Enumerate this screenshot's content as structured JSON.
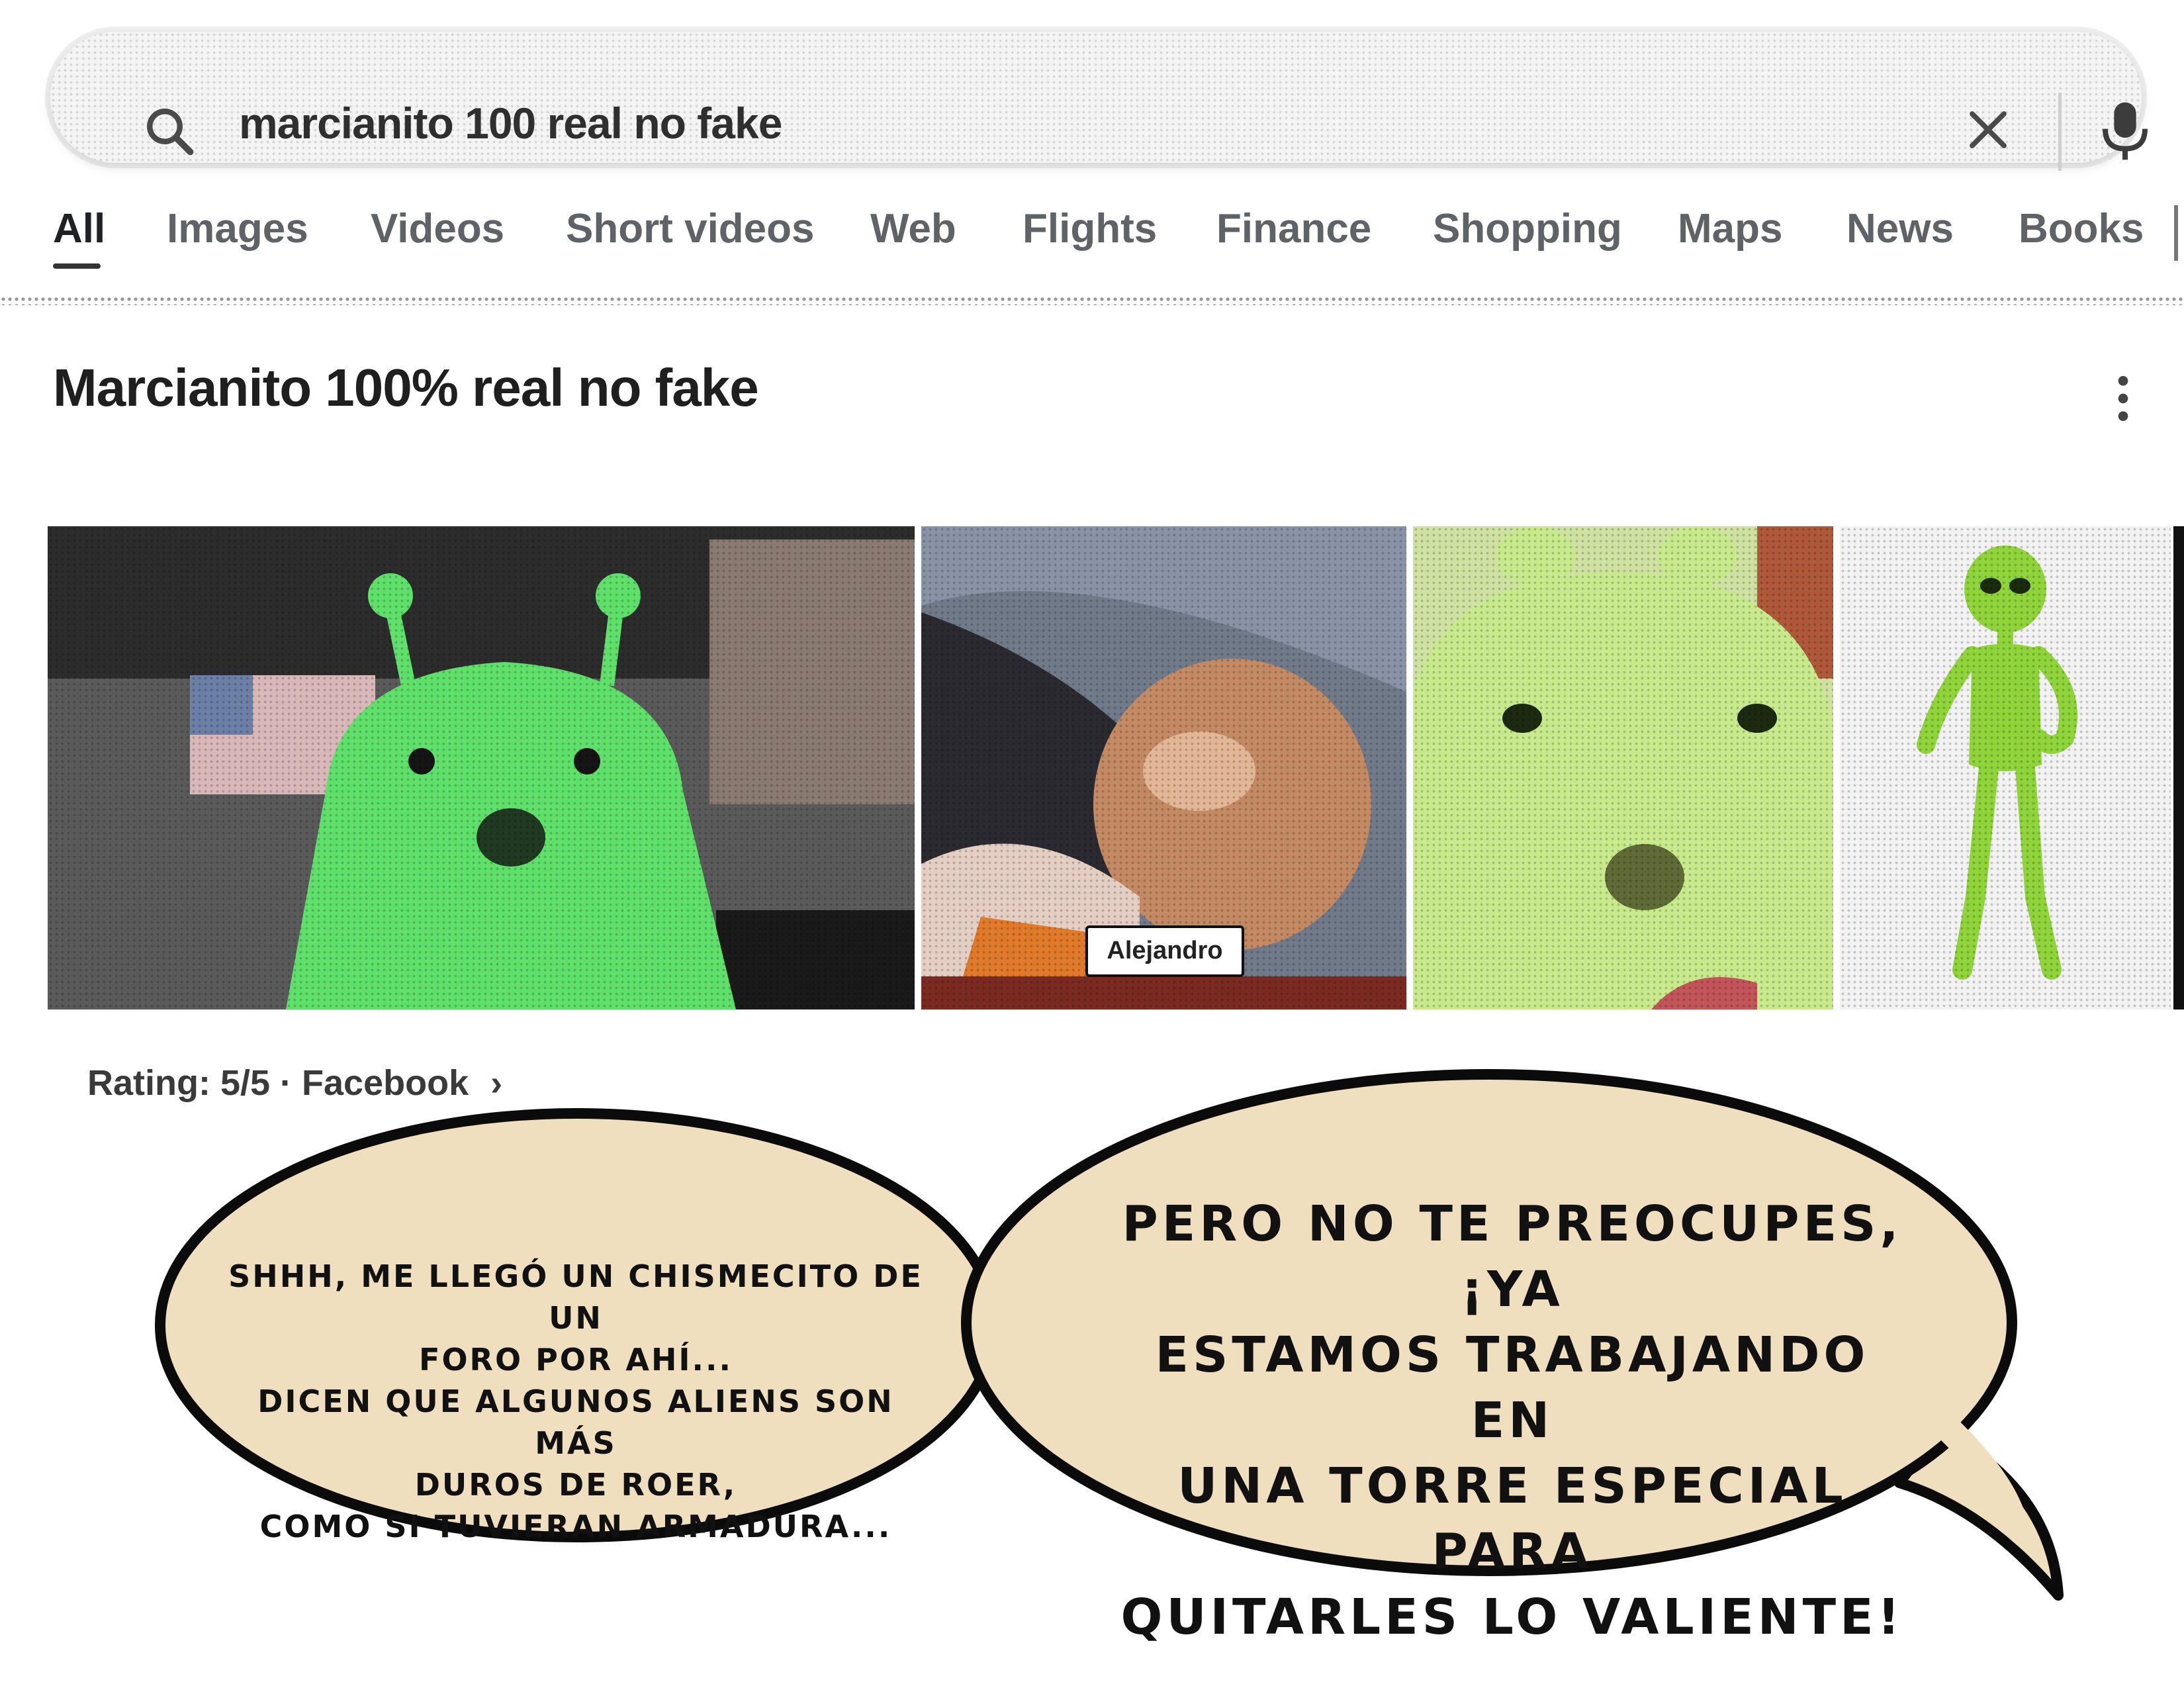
{
  "search": {
    "query": "marcianito 100 real no fake",
    "icons": {
      "search": "search-icon",
      "clear": "close-icon",
      "voice": "mic-icon"
    }
  },
  "tabs": [
    {
      "label": "All",
      "active": true
    },
    {
      "label": "Images"
    },
    {
      "label": "Videos"
    },
    {
      "label": "Short videos"
    },
    {
      "label": "Web"
    },
    {
      "label": "Flights"
    },
    {
      "label": "Finance"
    },
    {
      "label": "Shopping"
    },
    {
      "label": "Maps"
    },
    {
      "label": "News"
    },
    {
      "label": "Books"
    }
  ],
  "result": {
    "title": "Marcianito 100% real no fake",
    "more_icon": "more-vert-icon",
    "image_source_label": "Alejandro",
    "meta": "Rating: 5/5 · Facebook",
    "meta_chevron": "›"
  },
  "bubbles": {
    "left": {
      "lines": [
        "Shhh, me llegó un chismecito de un",
        "foro por ahí...",
        "Dicen que algunos aliens son más",
        "duros de roer,",
        "como si tuvieran armadura..."
      ]
    },
    "right": {
      "lines": [
        "Pero no te preocupes, ¡ya",
        "estamos trabajando en",
        "una torre especial para",
        "quitarles lo valiente!"
      ]
    }
  },
  "colors": {
    "bubble_fill": "#efdfbf",
    "bubble_stroke": "#0b0b0b",
    "alien_green": "#5fe06a",
    "alien_light": "#c9ea8c"
  }
}
